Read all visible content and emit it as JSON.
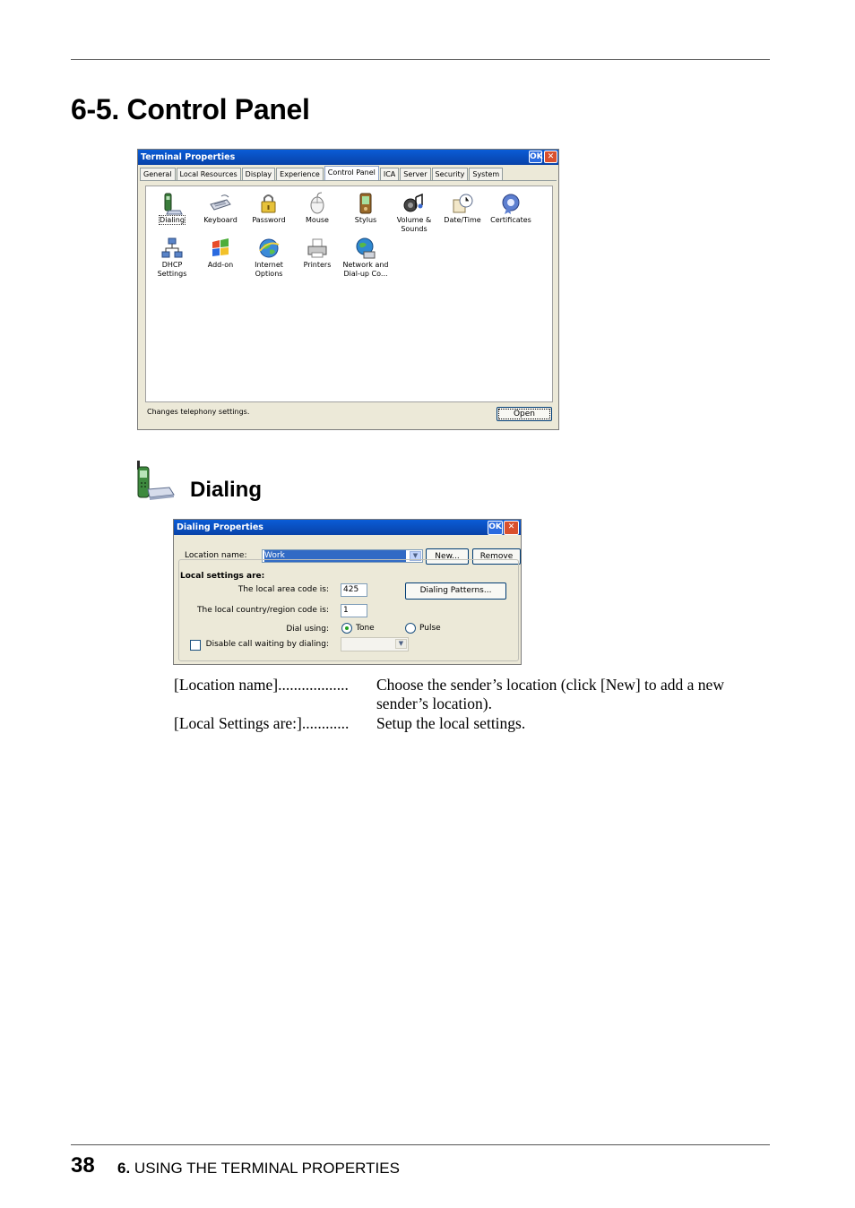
{
  "page": {
    "title": "6-5. Control Panel",
    "footer_number": "38",
    "footer_chapter": "6.",
    "footer_text": "USING THE TERMINAL PROPERTIES"
  },
  "terminal_props": {
    "title": "Terminal Properties",
    "ok": "OK",
    "close": "✕",
    "tabs": [
      "General",
      "Local Resources",
      "Display",
      "Experience",
      "Control Panel",
      "ICA",
      "Server",
      "Security",
      "System"
    ],
    "icons": [
      {
        "label": "Dialing",
        "icon": "dialing-icon"
      },
      {
        "label": "Keyboard",
        "icon": "keyboard-icon"
      },
      {
        "label": "Password",
        "icon": "password-icon"
      },
      {
        "label": "Mouse",
        "icon": "mouse-icon"
      },
      {
        "label": "Stylus",
        "icon": "stylus-icon"
      },
      {
        "label": "Volume & Sounds",
        "icon": "volume-icon"
      },
      {
        "label": "Date/Time",
        "icon": "date-time-icon"
      },
      {
        "label": "Certificates",
        "icon": "certificates-icon"
      },
      {
        "label": "DHCP Settings",
        "icon": "dhcp-icon"
      },
      {
        "label": "Add-on",
        "icon": "add-on-icon"
      },
      {
        "label": "Internet Options",
        "icon": "internet-options-icon"
      },
      {
        "label": "Printers",
        "icon": "printers-icon"
      },
      {
        "label": "Network and Dial-up Co...",
        "icon": "network-icon"
      }
    ],
    "status": "Changes telephony settings.",
    "open_button": "Open"
  },
  "dialing": {
    "heading": "Dialing"
  },
  "dialing_props": {
    "title": "Dialing Properties",
    "ok": "OK",
    "close": "✕",
    "location_label": "Location name:",
    "location_value": "Work",
    "new_button": "New...",
    "remove_button": "Remove",
    "local_settings_label": "Local settings are:",
    "area_code_label": "The local area code is:",
    "area_code_value": "425",
    "country_label": "The local country/region code is:",
    "country_value": "1",
    "dial_using_label": "Dial using:",
    "tone_label": "Tone",
    "pulse_label": "Pulse",
    "call_waiting_label": "Disable call waiting by dialing:",
    "dialing_patterns_button": "Dialing Patterns..."
  },
  "descriptions": [
    {
      "term": "[Location name]..................",
      "def": "Choose the sender’s location (click [New] to add a new sender’s location)."
    },
    {
      "term": "[Local Settings are:]............",
      "def": "Setup the local settings."
    }
  ]
}
